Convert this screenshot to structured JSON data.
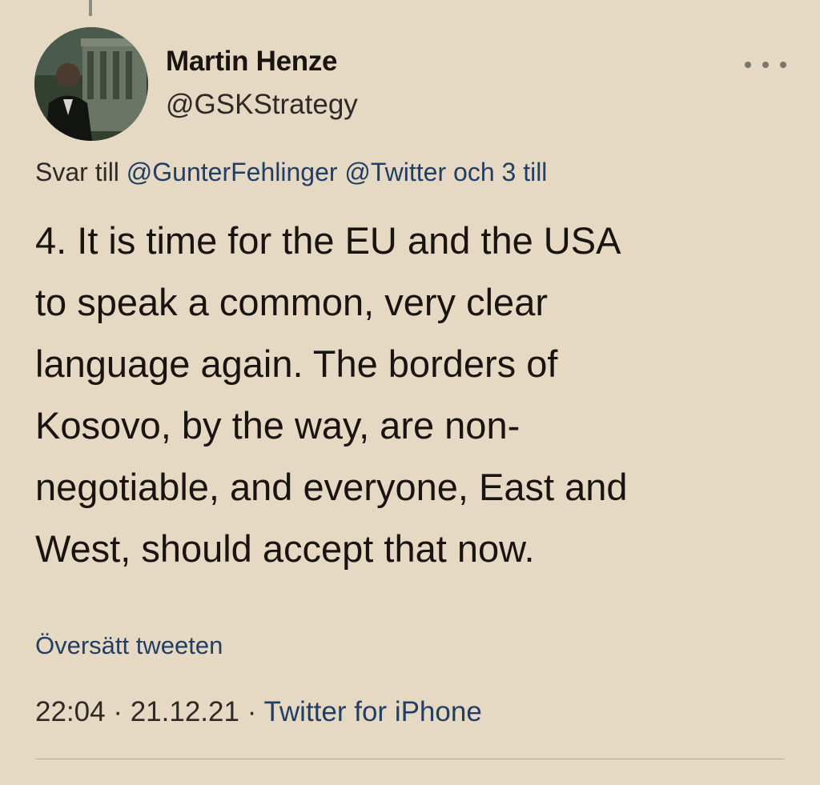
{
  "tweet": {
    "author_name": "Martin Henze",
    "author_handle": "@GSKStrategy",
    "reply": {
      "prefix": "Svar till",
      "mention1": "@GunterFehlinger",
      "mention2": "@Twitter",
      "suffix": "och 3 till"
    },
    "text_lines": [
      "4. It is time for the EU and the USA",
      "to speak a common, very clear",
      "language again. The borders of",
      "Kosovo, by the way, are non-",
      "negotiable, and everyone, East and",
      "West, should accept that now."
    ],
    "translate_label": "Översätt tweeten",
    "time": "22:04",
    "date": "21.12.21",
    "separator": "·",
    "source": "Twitter for iPhone"
  },
  "icons": {
    "more": "more-horizontal-icon"
  },
  "colors": {
    "background": "#e6d9c4",
    "text": "#1a1410",
    "link": "#233e63",
    "muted": "#7a776d"
  }
}
